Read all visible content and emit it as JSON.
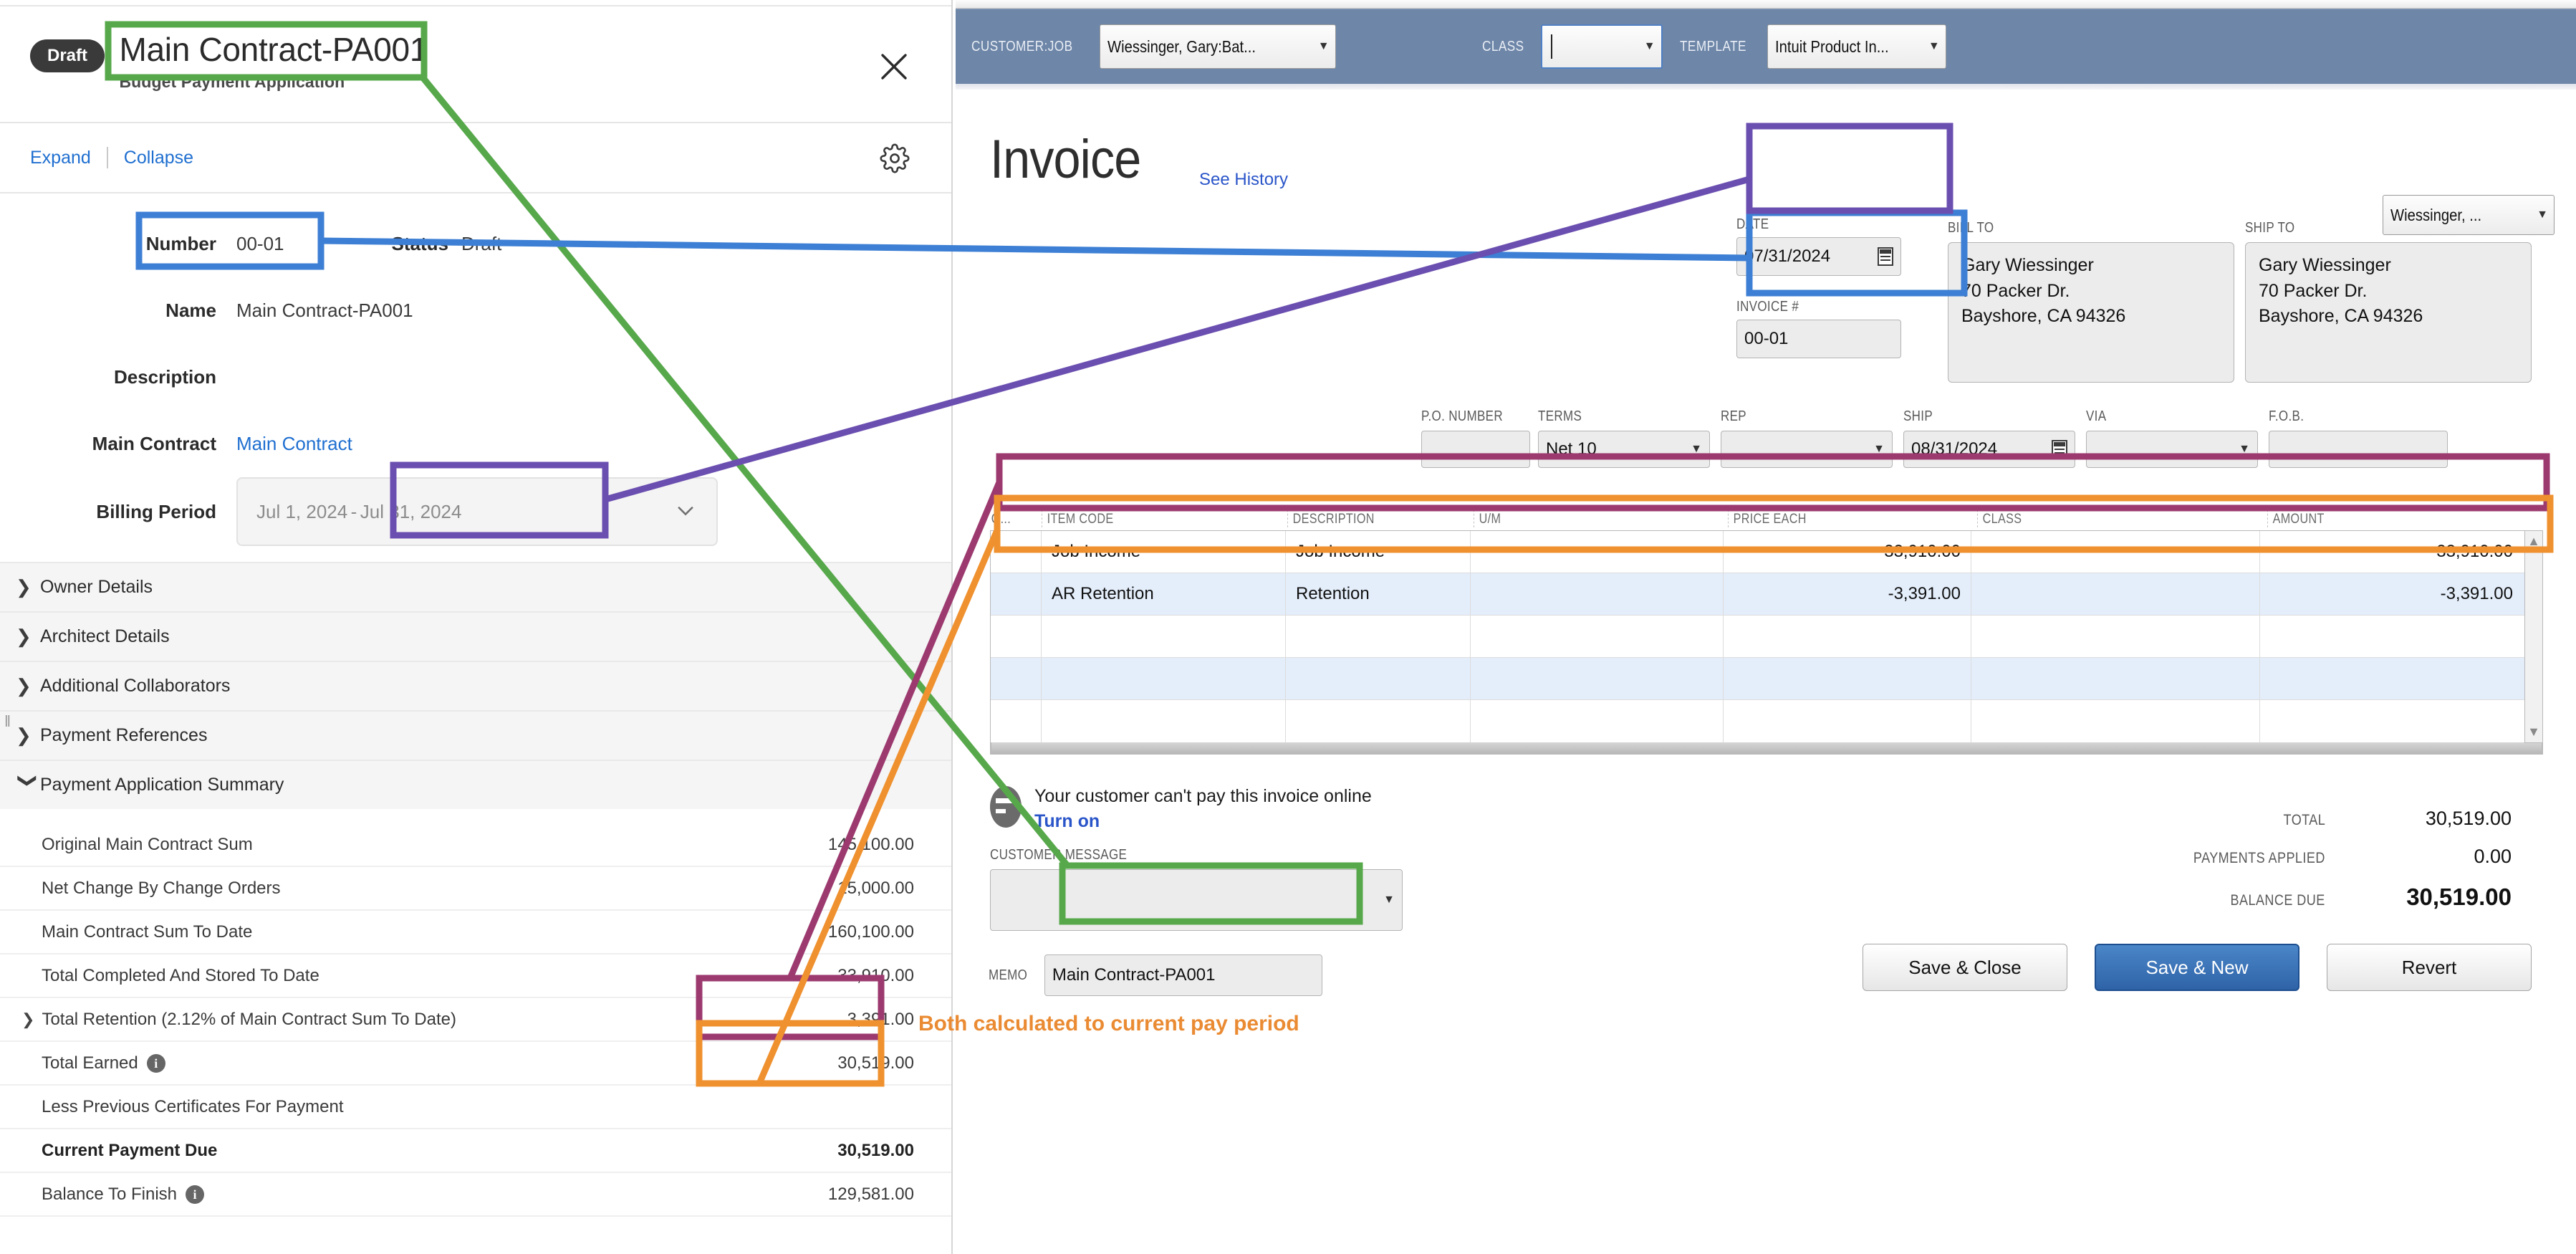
{
  "left_panel": {
    "status_chip": "Draft",
    "title": "Main Contract-PA001",
    "subtitle": "Budget Payment Application",
    "close_icon": "close-icon",
    "expand_label": "Expand",
    "collapse_label": "Collapse",
    "gear_icon": "gear-icon",
    "fields": {
      "number_label": "Number",
      "number_value": "00-01",
      "status_label": "Status",
      "status_value": "Draft",
      "name_label": "Name",
      "name_value": "Main Contract-PA001",
      "description_label": "Description",
      "description_value": "",
      "main_contract_label": "Main Contract",
      "main_contract_value": "Main Contract",
      "billing_period_label": "Billing Period",
      "billing_period_start": "Jul 1, 2024",
      "billing_period_sep": "-",
      "billing_period_end": "Jul 31, 2024"
    },
    "sections": [
      {
        "label": "Owner Details",
        "expanded": false
      },
      {
        "label": "Architect Details",
        "expanded": false
      },
      {
        "label": "Additional Collaborators",
        "expanded": false
      },
      {
        "label": "Payment References",
        "expanded": false
      },
      {
        "label": "Payment Application Summary",
        "expanded": true
      }
    ],
    "summary_rows": [
      {
        "name": "Original Main Contract Sum",
        "value": "145,100.00",
        "bold": false,
        "chevron": false,
        "info": false
      },
      {
        "name": "Net Change By Change Orders",
        "value": "15,000.00",
        "bold": false,
        "chevron": false,
        "info": false
      },
      {
        "name": "Main Contract Sum To Date",
        "value": "160,100.00",
        "bold": false,
        "chevron": false,
        "info": false
      },
      {
        "name": "Total Completed And Stored To Date",
        "value": "33,910.00",
        "bold": false,
        "chevron": false,
        "info": false
      },
      {
        "name": "Total Retention (2.12% of Main Contract Sum To Date)",
        "value": "3,391.00",
        "bold": false,
        "chevron": true,
        "info": false
      },
      {
        "name": "Total Earned",
        "value": "30,519.00",
        "bold": false,
        "chevron": false,
        "info": true
      },
      {
        "name": "Less Previous Certificates For Payment",
        "value": "",
        "bold": false,
        "chevron": false,
        "info": false
      },
      {
        "name": "Current Payment Due",
        "value": "30,519.00",
        "bold": true,
        "chevron": false,
        "info": false
      },
      {
        "name": "Balance To Finish",
        "value": "129,581.00",
        "bold": false,
        "chevron": false,
        "info": true
      }
    ]
  },
  "quickbooks": {
    "toolbar": {
      "customer_job_label": "CUSTOMER:JOB",
      "customer_job_value": "Wiessinger, Gary:Bat...",
      "class_label": "CLASS",
      "class_value": "",
      "template_label": "TEMPLATE",
      "template_value": "Intuit Product In..."
    },
    "title": "Invoice",
    "see_history": "See History",
    "date_label": "DATE",
    "date_value": "07/31/2024",
    "invoice_no_label": "INVOICE #",
    "invoice_no_value": "00-01",
    "bill_to_label": "BILL TO",
    "bill_to_lines": [
      "Gary Wiessinger",
      "70 Packer Dr.",
      "Bayshore, CA 94326"
    ],
    "ship_to_label": "SHIP TO",
    "ship_to_dropdown": "Wiessinger, ...",
    "ship_to_lines": [
      "Gary Wiessinger",
      "70 Packer Dr.",
      "Bayshore, CA 94326"
    ],
    "meta_fields": [
      {
        "label": "P.O. NUMBER",
        "value": "",
        "type": "text"
      },
      {
        "label": "TERMS",
        "value": "Net 10",
        "type": "combo"
      },
      {
        "label": "REP",
        "value": "",
        "type": "combo"
      },
      {
        "label": "SHIP",
        "value": "08/31/2024",
        "type": "date"
      },
      {
        "label": "VIA",
        "value": "",
        "type": "combo"
      },
      {
        "label": "F.O.B.",
        "value": "",
        "type": "text"
      }
    ],
    "items_columns": [
      "Q...",
      "ITEM CODE",
      "DESCRIPTION",
      "U/M",
      "PRICE EACH",
      "CLASS",
      "AMOUNT"
    ],
    "items_rows": [
      {
        "qty": "",
        "item_code": "Job Income",
        "description": "Job Income",
        "um": "",
        "price_each": "33,910.00",
        "class": "",
        "amount": "33,910.00"
      },
      {
        "qty": "",
        "item_code": "AR Retention",
        "description": "Retention",
        "um": "",
        "price_each": "-3,391.00",
        "class": "",
        "amount": "-3,391.00"
      },
      {
        "qty": "",
        "item_code": "",
        "description": "",
        "um": "",
        "price_each": "",
        "class": "",
        "amount": ""
      },
      {
        "qty": "",
        "item_code": "",
        "description": "",
        "um": "",
        "price_each": "",
        "class": "",
        "amount": ""
      },
      {
        "qty": "",
        "item_code": "",
        "description": "",
        "um": "",
        "price_each": "",
        "class": "",
        "amount": ""
      }
    ],
    "pay_note_title": "Your customer can't pay this invoice online",
    "pay_note_link": "Turn on",
    "customer_message_label": "CUSTOMER MESSAGE",
    "customer_message_value": "",
    "memo_label": "MEMO",
    "memo_value": "Main Contract-PA001",
    "totals": [
      {
        "label": "TOTAL",
        "value": "30,519.00",
        "big": false
      },
      {
        "label": "PAYMENTS APPLIED",
        "value": "0.00",
        "big": false
      },
      {
        "label": "BALANCE DUE",
        "value": "30,519.00",
        "big": true
      }
    ],
    "buttons": [
      {
        "label": "Save & Close",
        "primary": false
      },
      {
        "label": "Save & New",
        "primary": true
      },
      {
        "label": "Revert",
        "primary": false
      }
    ]
  },
  "annotations": {
    "callout_text": "Both calculated to current pay period",
    "colors": {
      "green": "#57a84b",
      "blue": "#3d7fd4",
      "purple": "#6b4fb0",
      "magenta": "#9c3a6f",
      "orange": "#ef912f"
    }
  }
}
